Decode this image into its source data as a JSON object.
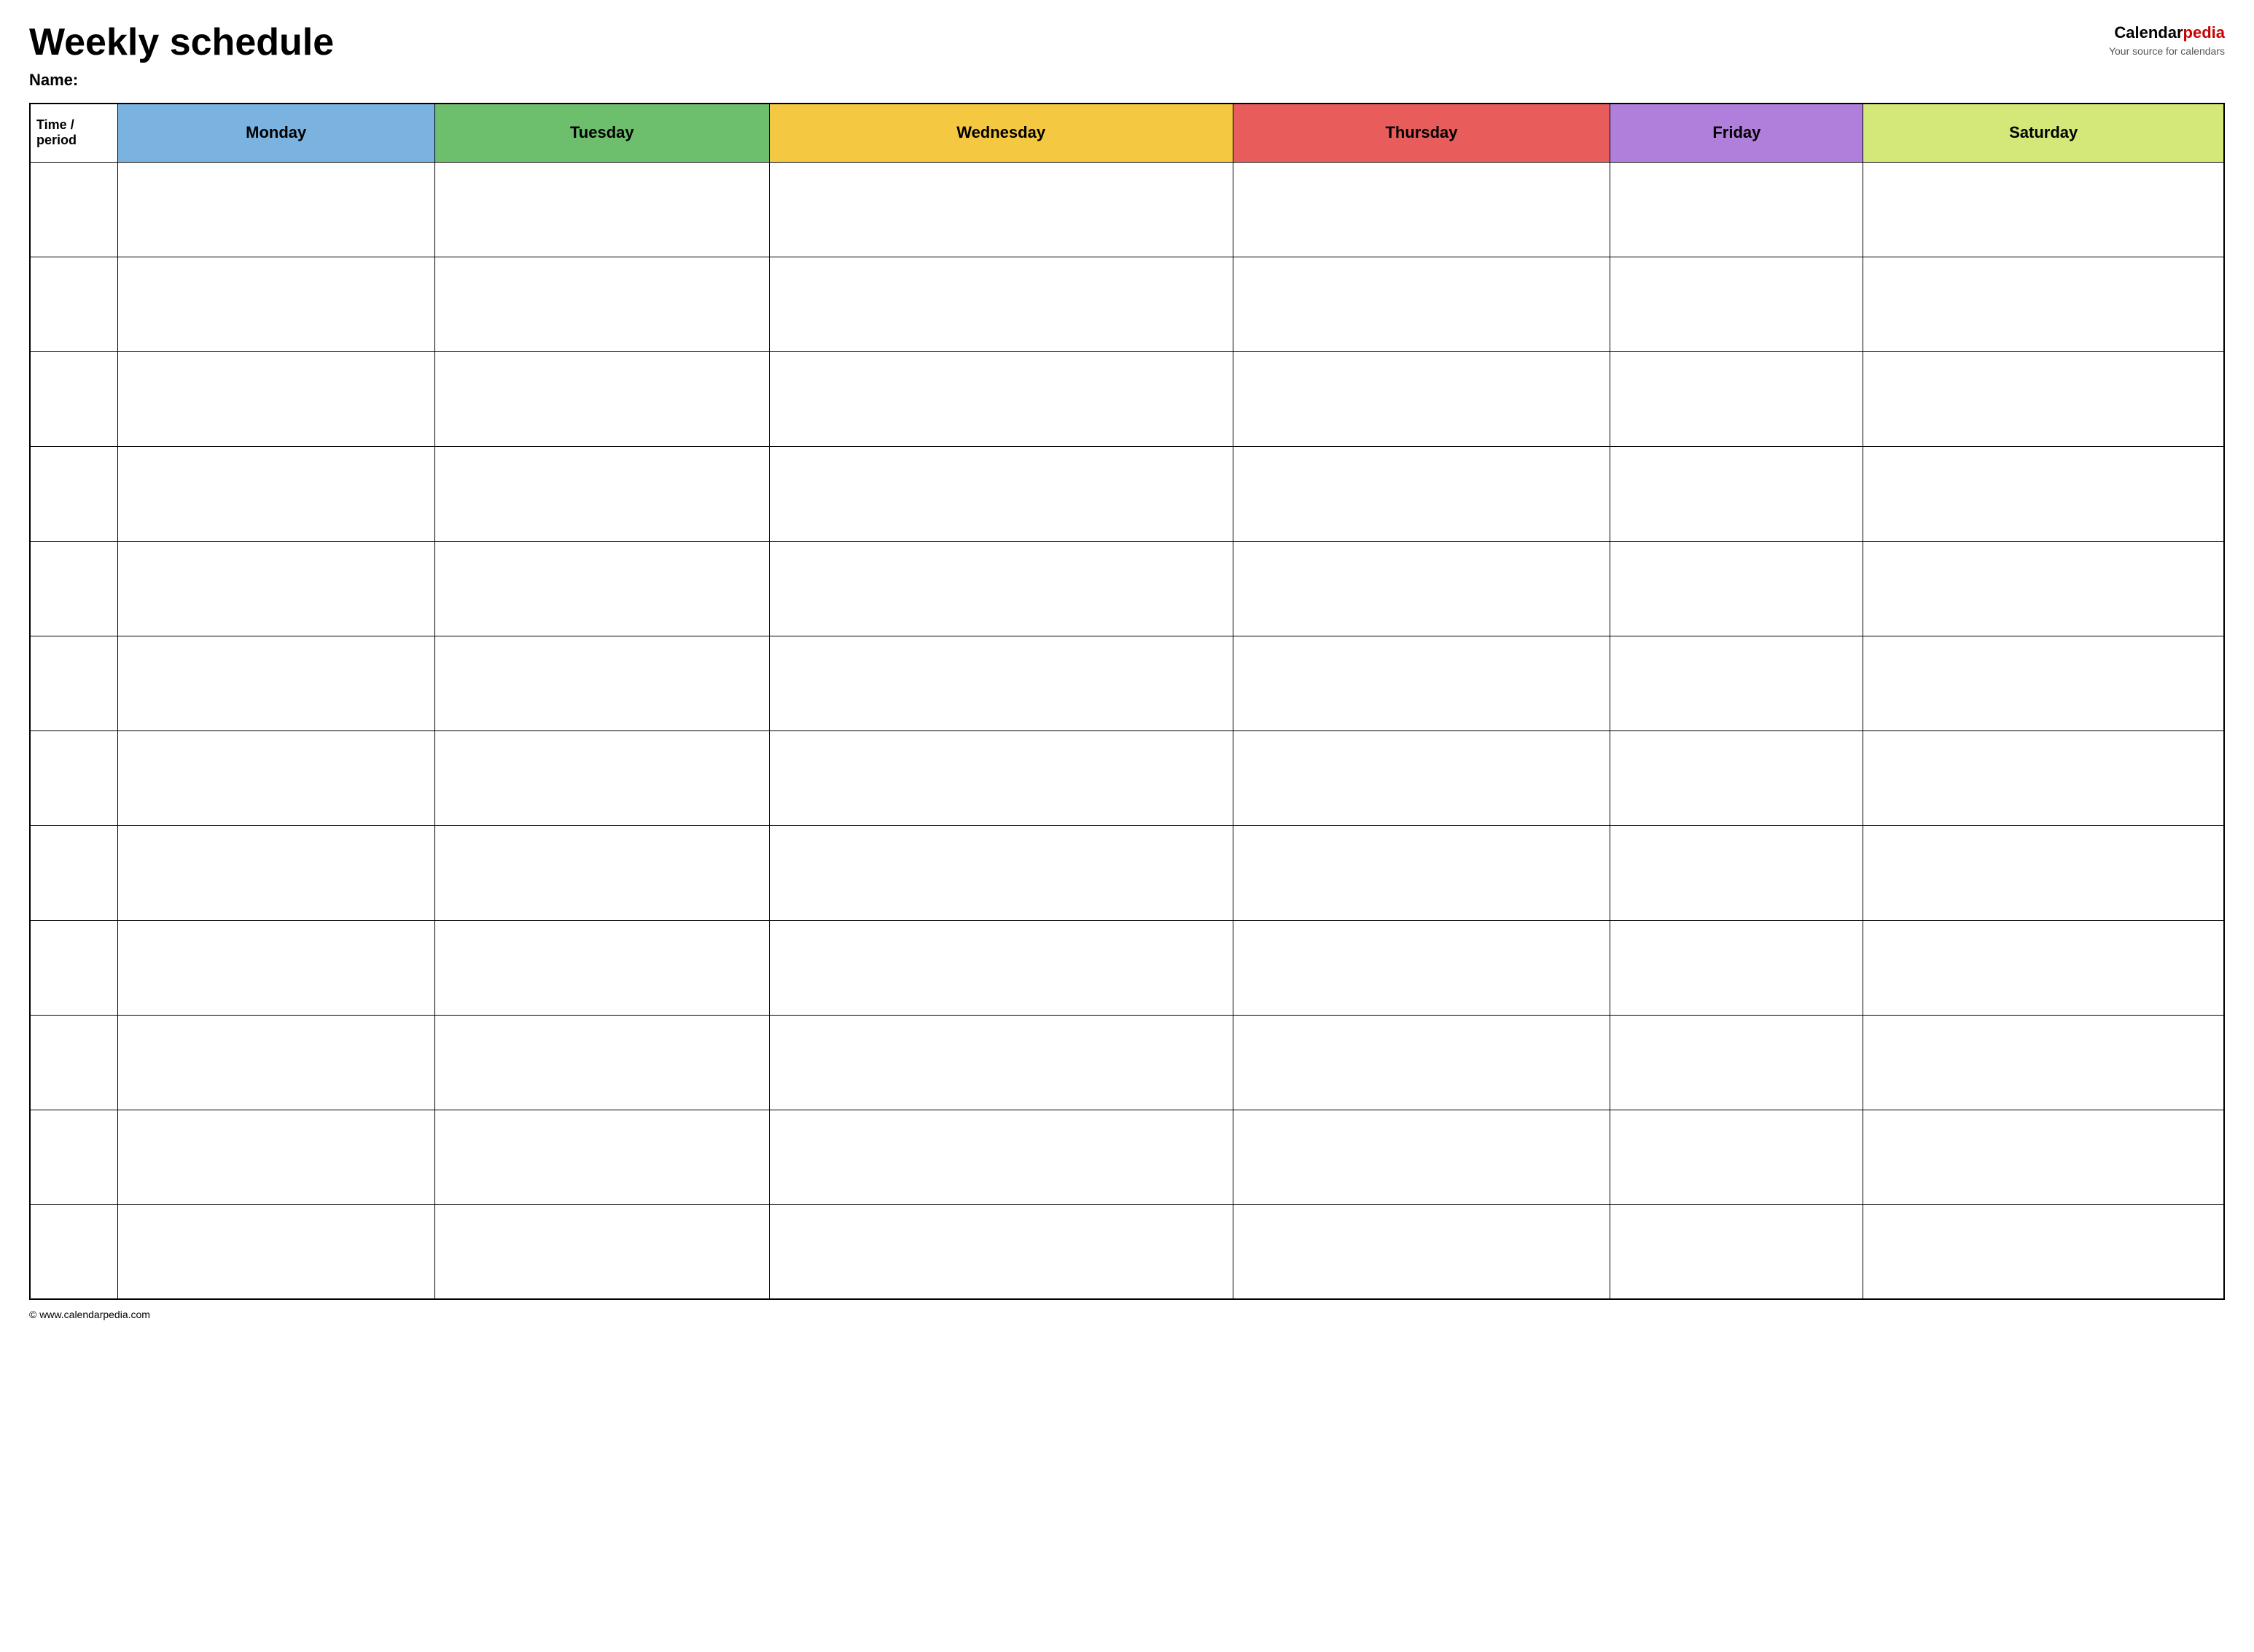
{
  "header": {
    "title": "Weekly schedule",
    "name_label": "Name:",
    "logo_calendar": "Calendar",
    "logo_pedia": "pedia",
    "logo_tagline": "Your source for calendars"
  },
  "table": {
    "columns": [
      {
        "key": "time",
        "label": "Time / period",
        "color": "#fff"
      },
      {
        "key": "monday",
        "label": "Monday",
        "color": "#7ab3e0"
      },
      {
        "key": "tuesday",
        "label": "Tuesday",
        "color": "#6dbf6d"
      },
      {
        "key": "wednesday",
        "label": "Wednesday",
        "color": "#f5c842"
      },
      {
        "key": "thursday",
        "label": "Thursday",
        "color": "#e85c5c"
      },
      {
        "key": "friday",
        "label": "Friday",
        "color": "#b07fdb"
      },
      {
        "key": "saturday",
        "label": "Saturday",
        "color": "#d4e87a"
      }
    ],
    "rows": 12
  },
  "footer": {
    "url": "© www.calendarpedia.com"
  }
}
